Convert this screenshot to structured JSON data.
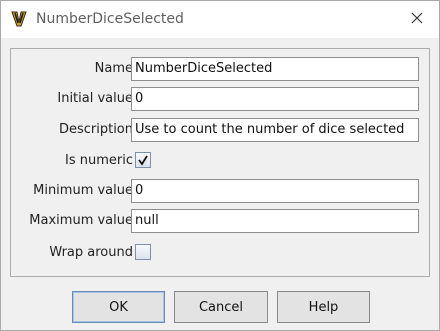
{
  "window": {
    "title": "NumberDiceSelected",
    "app_icon": "vassal-icon",
    "close_icon": "close-icon"
  },
  "form": {
    "name": {
      "label": "Name",
      "value": "NumberDiceSelected"
    },
    "initial_value": {
      "label": "Initial value",
      "value": "0"
    },
    "description": {
      "label": "Description",
      "value": "Use to count the number of dice selected"
    },
    "is_numeric": {
      "label": "Is numeric",
      "checked": true
    },
    "minimum_value": {
      "label": "Minimum value",
      "value": "0"
    },
    "maximum_value": {
      "label": "Maximum value",
      "value": "null"
    },
    "wrap_around": {
      "label": "Wrap around",
      "checked": false
    }
  },
  "buttons": {
    "ok": "OK",
    "cancel": "Cancel",
    "help": "Help"
  }
}
